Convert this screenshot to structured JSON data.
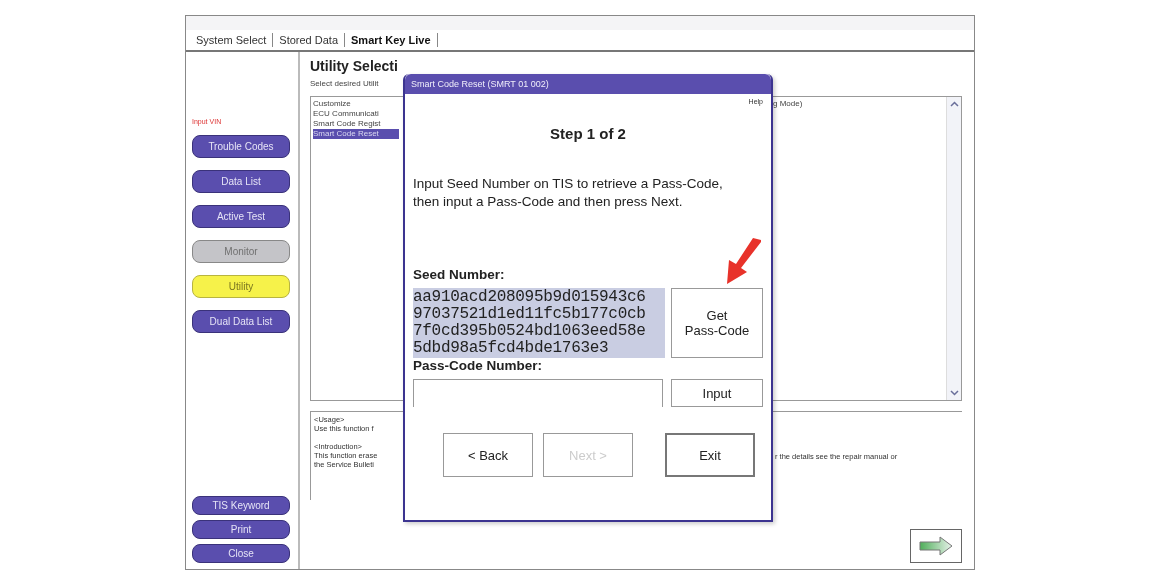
{
  "tabs": [
    {
      "label": "System Select",
      "selected": false
    },
    {
      "label": "Stored Data",
      "selected": false
    },
    {
      "label": "Smart Key Live",
      "selected": true
    }
  ],
  "sidebar": {
    "vin_label": "Input VIN",
    "buttons": [
      {
        "label": "Trouble Codes",
        "disabled": false,
        "selected": false
      },
      {
        "label": "Data List",
        "disabled": false,
        "selected": false
      },
      {
        "label": "Active Test",
        "disabled": false,
        "selected": false
      },
      {
        "label": "Monitor",
        "disabled": true,
        "selected": false
      },
      {
        "label": "Utility",
        "disabled": false,
        "selected": true
      },
      {
        "label": "Dual Data List",
        "disabled": false,
        "selected": false
      }
    ],
    "bottom_buttons": [
      "TIS Keyword",
      "Print",
      "Close"
    ]
  },
  "content": {
    "heading": "Utility Selecti",
    "subtitle": "Select desired Utilit",
    "list_items": [
      {
        "label": "Customize",
        "selected": false
      },
      {
        "label": "ECU Communicati",
        "selected": false
      },
      {
        "label": "Smart Code Regist",
        "selected": false
      },
      {
        "label": "Smart Code Reset",
        "selected": true
      }
    ],
    "list_right_text": "g Mode)",
    "usage_blocks": [
      [
        "<Usage>",
        "Use this function f"
      ],
      [
        "<Introduction>",
        "This function erase",
        "the Service Bulleti"
      ]
    ],
    "usage_right_text": "r the details see the repair manual or"
  },
  "dialog": {
    "title": "Smart Code Reset (SMRT 01 002)",
    "help": "Help",
    "step": "Step 1 of 2",
    "instruction": [
      "Input Seed Number on TIS to retrieve a Pass-Code,",
      "then input a Pass-Code and then press Next."
    ],
    "seed_label": "Seed Number:",
    "seed_lines": [
      "aa910acd208095b9d015943c6",
      "97037521d1ed11fc5b177c0cb",
      "7f0cd395b0524bd1063eed58e",
      "5dbd98a5fcd4bde1763e3"
    ],
    "get_button": [
      "Get",
      "Pass-Code"
    ],
    "passcode_label": "Pass-Code Number:",
    "input_button": "Input",
    "buttons": [
      {
        "label": "< Back",
        "disabled": false
      },
      {
        "label": "Next >",
        "disabled": true
      },
      {
        "label": "Exit",
        "disabled": false
      }
    ]
  }
}
